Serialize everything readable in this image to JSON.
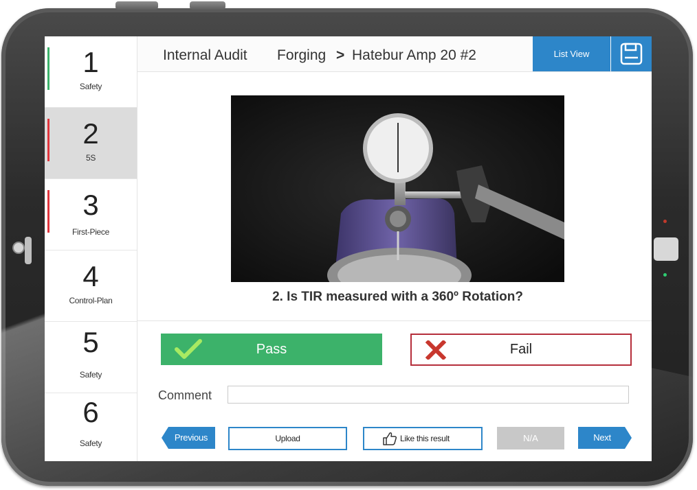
{
  "header": {
    "title": "Internal Audit",
    "breadcrumb_section": "Forging",
    "breadcrumb_separator": ">",
    "breadcrumb_item": "Hatebur Amp 20 #2",
    "list_view_label": "List View",
    "save_icon": "floppy-disk-icon"
  },
  "steps": [
    {
      "number": "1",
      "label": "Safety",
      "status_color": "#3cb26a"
    },
    {
      "number": "2",
      "label": "5S",
      "status_color": "#e0343c",
      "active": true
    },
    {
      "number": "3",
      "label": "First-Piece",
      "status_color": "#e0343c"
    },
    {
      "number": "4",
      "label": "Control-Plan"
    },
    {
      "number": "5",
      "label": "Safety"
    },
    {
      "number": "6",
      "label": "Safety"
    }
  ],
  "question": {
    "text": "2. Is TIR measured with a 360º Rotation?",
    "image": "dial-indicator-on-shaft-photo"
  },
  "answers": {
    "pass_label": "Pass",
    "pass_icon": "checkmark-icon",
    "pass_color": "#3cb26a",
    "fail_label": "Fail",
    "fail_icon": "x-mark-icon",
    "fail_color": "#b52d3a"
  },
  "comment": {
    "label": "Comment",
    "value": ""
  },
  "footer": {
    "previous_label": "Previous",
    "upload_label": "Upload",
    "like_label": "Like this result",
    "like_icon": "thumbs-up-icon",
    "na_label": "N/A",
    "next_label": "Next"
  },
  "colors": {
    "accent_blue": "#2d86c9"
  }
}
